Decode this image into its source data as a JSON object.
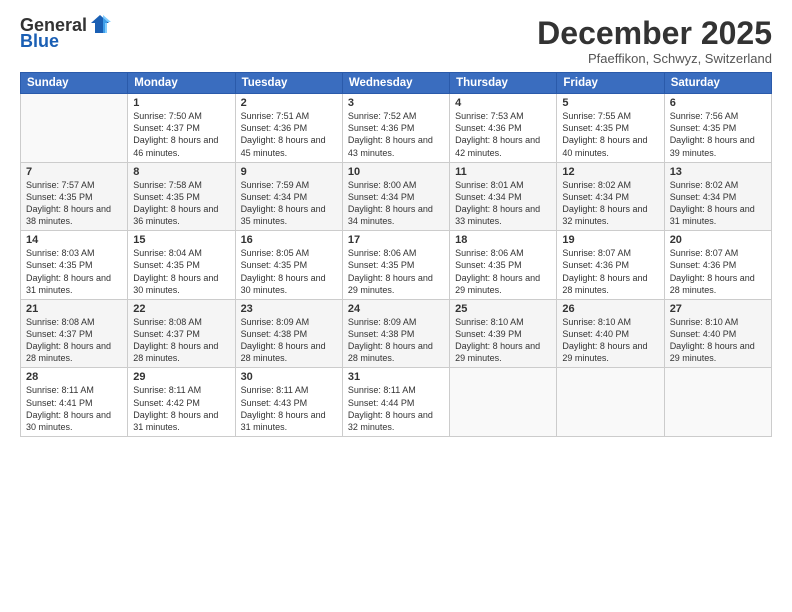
{
  "header": {
    "logo_general": "General",
    "logo_blue": "Blue",
    "month_title": "December 2025",
    "subtitle": "Pfaeffikon, Schwyz, Switzerland"
  },
  "days_of_week": [
    "Sunday",
    "Monday",
    "Tuesday",
    "Wednesday",
    "Thursday",
    "Friday",
    "Saturday"
  ],
  "weeks": [
    [
      {
        "day": "",
        "sunrise": "",
        "sunset": "",
        "daylight": ""
      },
      {
        "day": "1",
        "sunrise": "Sunrise: 7:50 AM",
        "sunset": "Sunset: 4:37 PM",
        "daylight": "Daylight: 8 hours and 46 minutes."
      },
      {
        "day": "2",
        "sunrise": "Sunrise: 7:51 AM",
        "sunset": "Sunset: 4:36 PM",
        "daylight": "Daylight: 8 hours and 45 minutes."
      },
      {
        "day": "3",
        "sunrise": "Sunrise: 7:52 AM",
        "sunset": "Sunset: 4:36 PM",
        "daylight": "Daylight: 8 hours and 43 minutes."
      },
      {
        "day": "4",
        "sunrise": "Sunrise: 7:53 AM",
        "sunset": "Sunset: 4:36 PM",
        "daylight": "Daylight: 8 hours and 42 minutes."
      },
      {
        "day": "5",
        "sunrise": "Sunrise: 7:55 AM",
        "sunset": "Sunset: 4:35 PM",
        "daylight": "Daylight: 8 hours and 40 minutes."
      },
      {
        "day": "6",
        "sunrise": "Sunrise: 7:56 AM",
        "sunset": "Sunset: 4:35 PM",
        "daylight": "Daylight: 8 hours and 39 minutes."
      }
    ],
    [
      {
        "day": "7",
        "sunrise": "Sunrise: 7:57 AM",
        "sunset": "Sunset: 4:35 PM",
        "daylight": "Daylight: 8 hours and 38 minutes."
      },
      {
        "day": "8",
        "sunrise": "Sunrise: 7:58 AM",
        "sunset": "Sunset: 4:35 PM",
        "daylight": "Daylight: 8 hours and 36 minutes."
      },
      {
        "day": "9",
        "sunrise": "Sunrise: 7:59 AM",
        "sunset": "Sunset: 4:34 PM",
        "daylight": "Daylight: 8 hours and 35 minutes."
      },
      {
        "day": "10",
        "sunrise": "Sunrise: 8:00 AM",
        "sunset": "Sunset: 4:34 PM",
        "daylight": "Daylight: 8 hours and 34 minutes."
      },
      {
        "day": "11",
        "sunrise": "Sunrise: 8:01 AM",
        "sunset": "Sunset: 4:34 PM",
        "daylight": "Daylight: 8 hours and 33 minutes."
      },
      {
        "day": "12",
        "sunrise": "Sunrise: 8:02 AM",
        "sunset": "Sunset: 4:34 PM",
        "daylight": "Daylight: 8 hours and 32 minutes."
      },
      {
        "day": "13",
        "sunrise": "Sunrise: 8:02 AM",
        "sunset": "Sunset: 4:34 PM",
        "daylight": "Daylight: 8 hours and 31 minutes."
      }
    ],
    [
      {
        "day": "14",
        "sunrise": "Sunrise: 8:03 AM",
        "sunset": "Sunset: 4:35 PM",
        "daylight": "Daylight: 8 hours and 31 minutes."
      },
      {
        "day": "15",
        "sunrise": "Sunrise: 8:04 AM",
        "sunset": "Sunset: 4:35 PM",
        "daylight": "Daylight: 8 hours and 30 minutes."
      },
      {
        "day": "16",
        "sunrise": "Sunrise: 8:05 AM",
        "sunset": "Sunset: 4:35 PM",
        "daylight": "Daylight: 8 hours and 30 minutes."
      },
      {
        "day": "17",
        "sunrise": "Sunrise: 8:06 AM",
        "sunset": "Sunset: 4:35 PM",
        "daylight": "Daylight: 8 hours and 29 minutes."
      },
      {
        "day": "18",
        "sunrise": "Sunrise: 8:06 AM",
        "sunset": "Sunset: 4:35 PM",
        "daylight": "Daylight: 8 hours and 29 minutes."
      },
      {
        "day": "19",
        "sunrise": "Sunrise: 8:07 AM",
        "sunset": "Sunset: 4:36 PM",
        "daylight": "Daylight: 8 hours and 28 minutes."
      },
      {
        "day": "20",
        "sunrise": "Sunrise: 8:07 AM",
        "sunset": "Sunset: 4:36 PM",
        "daylight": "Daylight: 8 hours and 28 minutes."
      }
    ],
    [
      {
        "day": "21",
        "sunrise": "Sunrise: 8:08 AM",
        "sunset": "Sunset: 4:37 PM",
        "daylight": "Daylight: 8 hours and 28 minutes."
      },
      {
        "day": "22",
        "sunrise": "Sunrise: 8:08 AM",
        "sunset": "Sunset: 4:37 PM",
        "daylight": "Daylight: 8 hours and 28 minutes."
      },
      {
        "day": "23",
        "sunrise": "Sunrise: 8:09 AM",
        "sunset": "Sunset: 4:38 PM",
        "daylight": "Daylight: 8 hours and 28 minutes."
      },
      {
        "day": "24",
        "sunrise": "Sunrise: 8:09 AM",
        "sunset": "Sunset: 4:38 PM",
        "daylight": "Daylight: 8 hours and 28 minutes."
      },
      {
        "day": "25",
        "sunrise": "Sunrise: 8:10 AM",
        "sunset": "Sunset: 4:39 PM",
        "daylight": "Daylight: 8 hours and 29 minutes."
      },
      {
        "day": "26",
        "sunrise": "Sunrise: 8:10 AM",
        "sunset": "Sunset: 4:40 PM",
        "daylight": "Daylight: 8 hours and 29 minutes."
      },
      {
        "day": "27",
        "sunrise": "Sunrise: 8:10 AM",
        "sunset": "Sunset: 4:40 PM",
        "daylight": "Daylight: 8 hours and 29 minutes."
      }
    ],
    [
      {
        "day": "28",
        "sunrise": "Sunrise: 8:11 AM",
        "sunset": "Sunset: 4:41 PM",
        "daylight": "Daylight: 8 hours and 30 minutes."
      },
      {
        "day": "29",
        "sunrise": "Sunrise: 8:11 AM",
        "sunset": "Sunset: 4:42 PM",
        "daylight": "Daylight: 8 hours and 31 minutes."
      },
      {
        "day": "30",
        "sunrise": "Sunrise: 8:11 AM",
        "sunset": "Sunset: 4:43 PM",
        "daylight": "Daylight: 8 hours and 31 minutes."
      },
      {
        "day": "31",
        "sunrise": "Sunrise: 8:11 AM",
        "sunset": "Sunset: 4:44 PM",
        "daylight": "Daylight: 8 hours and 32 minutes."
      },
      {
        "day": "",
        "sunrise": "",
        "sunset": "",
        "daylight": ""
      },
      {
        "day": "",
        "sunrise": "",
        "sunset": "",
        "daylight": ""
      },
      {
        "day": "",
        "sunrise": "",
        "sunset": "",
        "daylight": ""
      }
    ]
  ]
}
